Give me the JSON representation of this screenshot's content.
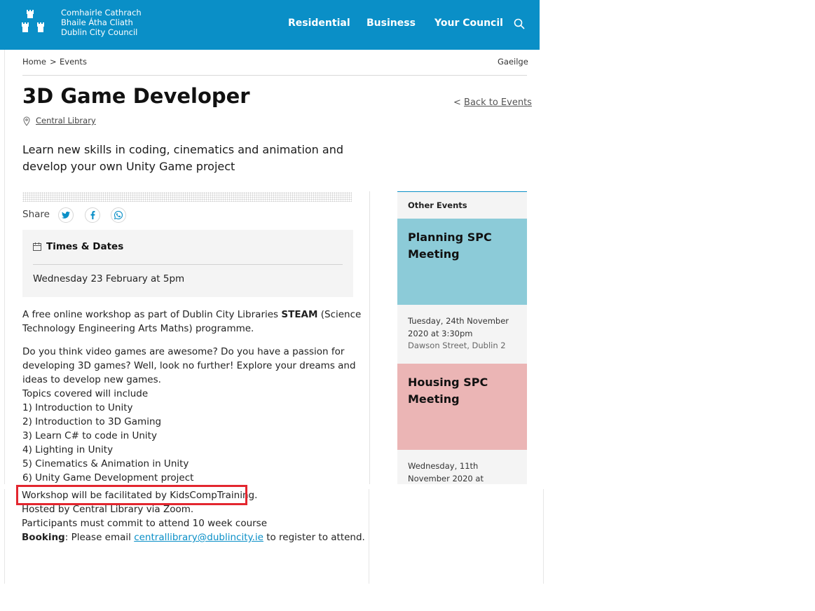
{
  "header": {
    "logo_lines": [
      "Comhairle Cathrach",
      "Bhaile Átha Cliath",
      "Dublin City Council"
    ],
    "nav": [
      "Residential",
      "Business",
      "Your Council"
    ],
    "brand_color": "#0a8fc7"
  },
  "breadcrumb": {
    "home": "Home",
    "separator": ">",
    "current": "Events",
    "language": "Gaeilge"
  },
  "event": {
    "title": "3D Game Developer",
    "location": "Central Library",
    "back_prefix": "<",
    "back_label": "Back to Events",
    "intro_line1": "Learn new skills in coding, cinematics and animation and",
    "intro_line2": "develop your own Unity Game project",
    "share_label": "Share",
    "times_title": "Times & Dates",
    "times_value": "Wednesday 23 February at 5pm"
  },
  "description": {
    "p1_a": "A free online workshop as part of Dublin City Libraries ",
    "p1_bold": "STEAM",
    "p1_b": " (Science",
    "p1_line2": "Technology Engineering Arts Maths) programme.",
    "p2_lines": [
      "Do you think video games are awesome? Do you have a passion for",
      "developing 3D games? Well, look no further!  Explore your dreams and",
      "ideas to develop new games.",
      "Topics covered will include",
      "1) Introduction to Unity",
      "2) Introduction to 3D Gaming",
      "3) Learn C# to code in Unity",
      "4) Lighting in Unity",
      "5) Cinematics & Animation in Unity",
      "6) Unity Game Development project"
    ],
    "lower_lines": [
      "Workshop will be facilitated by KidsCompTraining.",
      "Hosted by Central Library via Zoom.",
      "Participants must commit to attend 10 week course"
    ],
    "booking_bold": "Booking",
    "booking_a": ": Please email ",
    "booking_email": "centrallibrary@dublincity.ie",
    "booking_b": " to register to attend."
  },
  "sidebar": {
    "heading": "Other Events",
    "cards": [
      {
        "title_line1": "Planning SPC",
        "title_line2": "Meeting",
        "date_line1": "Tuesday, 24th November",
        "date_line2": "2020 at 3:30pm",
        "place": "Dawson Street, Dublin 2",
        "color": "#8ccbd8"
      },
      {
        "title_line1": "Housing SPC",
        "title_line2": "Meeting",
        "date_line1": "Wednesday, 11th",
        "date_line2": "November 2020 at",
        "color": "#ebb5b5"
      }
    ]
  },
  "icons": {
    "logo": "castles-logo-icon",
    "search": "search-icon",
    "location": "location-pin-icon",
    "calendar": "calendar-icon",
    "share": [
      "twitter-icon",
      "facebook-icon",
      "whatsapp-icon"
    ]
  },
  "annotation": {
    "highlight_color": "#e3262f"
  }
}
